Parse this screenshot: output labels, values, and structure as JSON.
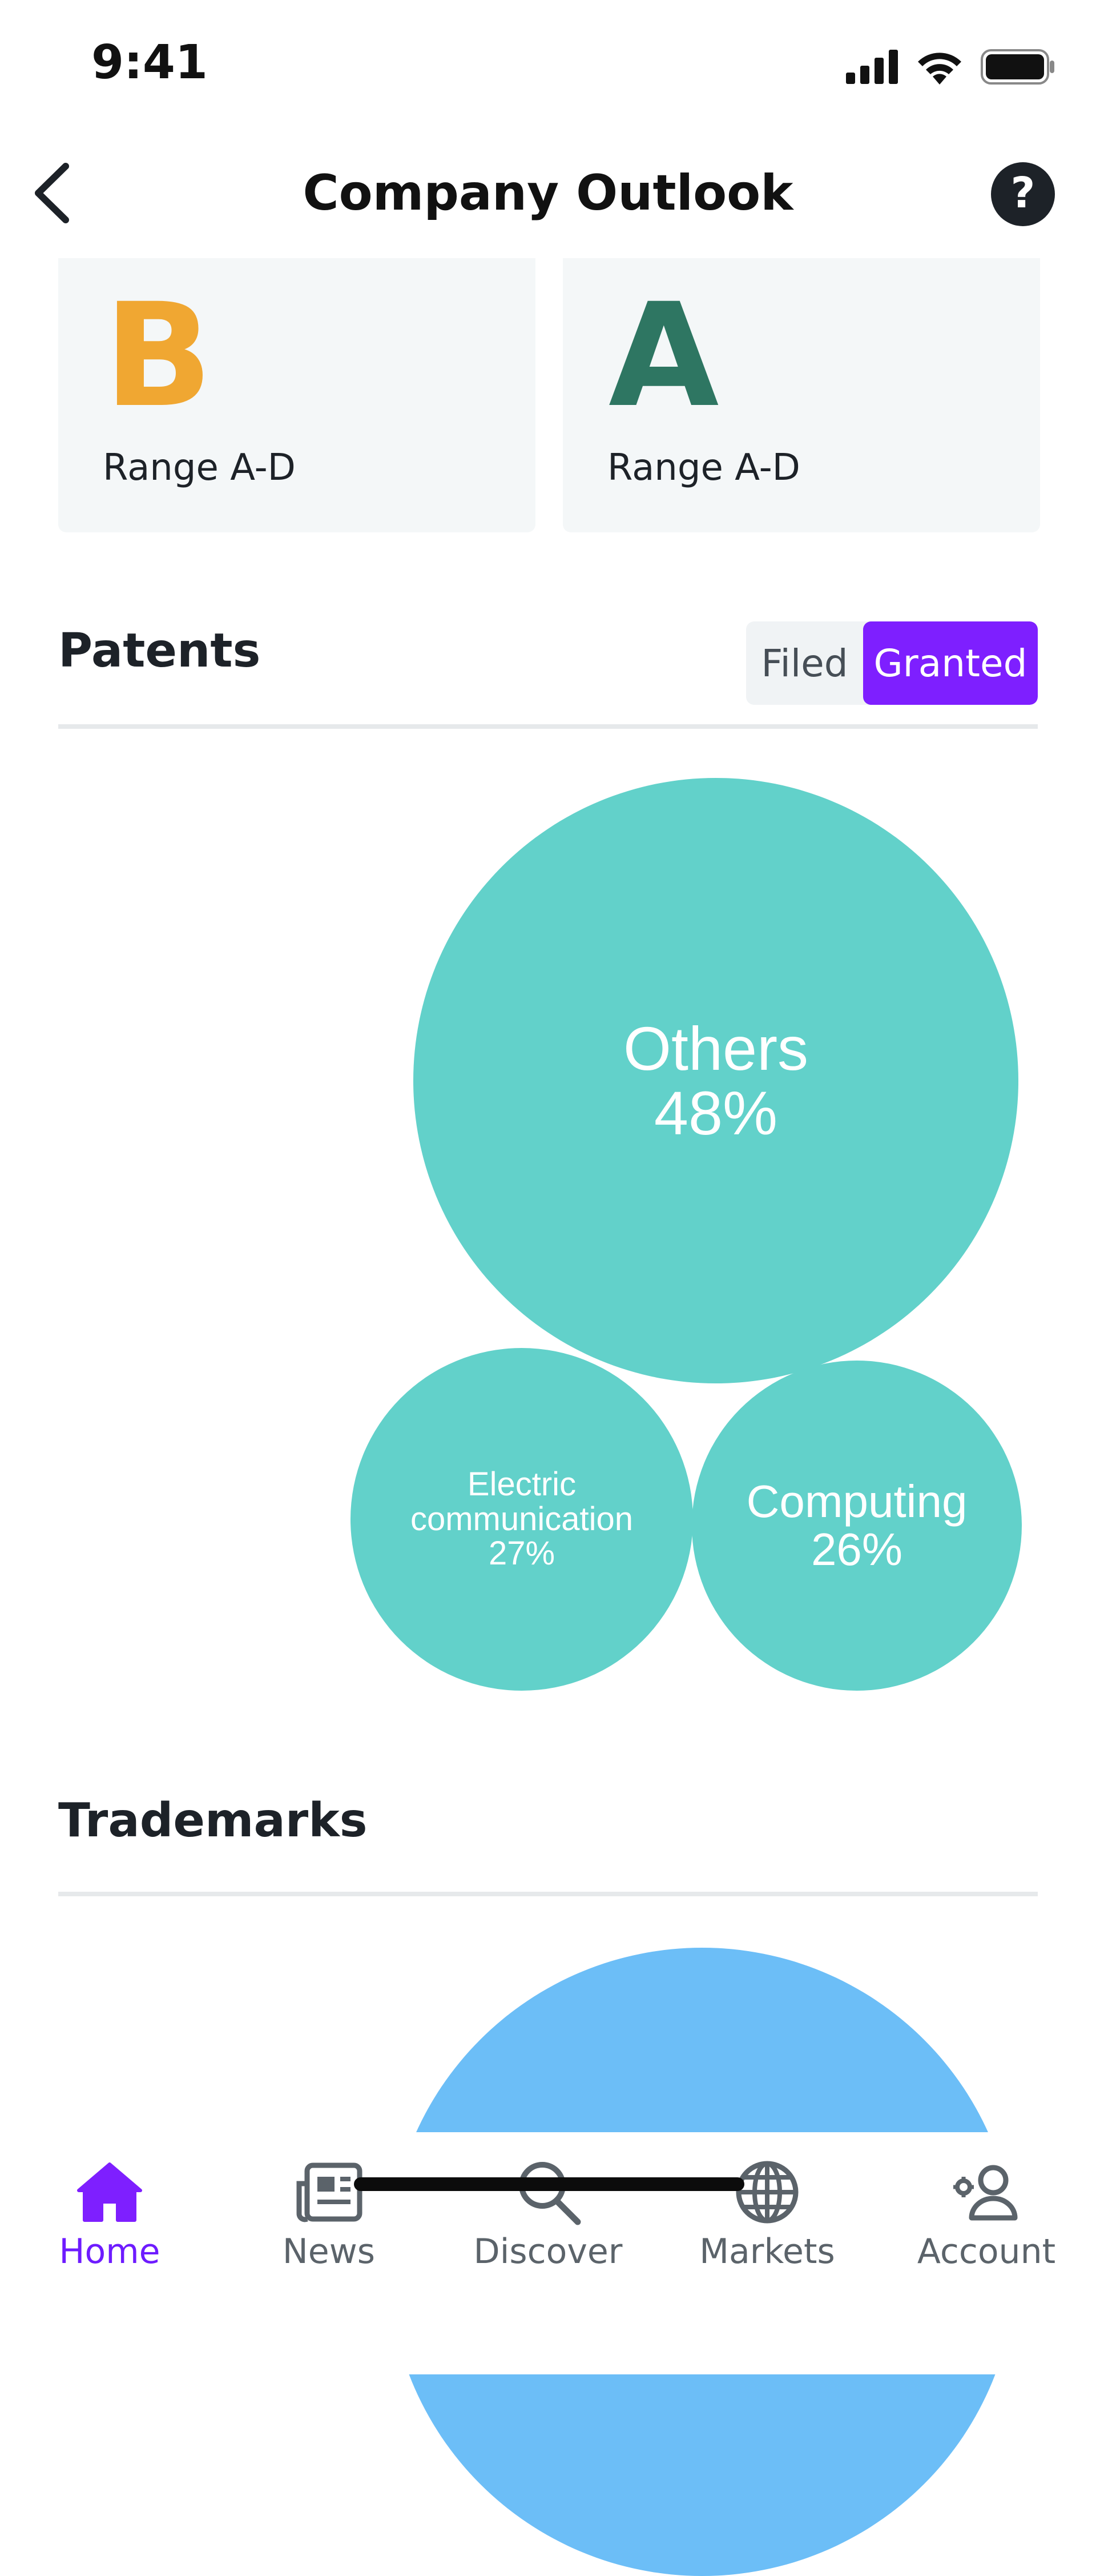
{
  "status_bar": {
    "time": "9:41",
    "icons": [
      "signal-icon",
      "wifi-icon",
      "battery-icon"
    ]
  },
  "header": {
    "title": "Company Outlook",
    "back_icon": "chevron-left-icon",
    "help_label": "?"
  },
  "grade_cards": [
    {
      "grade": "B",
      "range": "Range A-D",
      "color": "#f0a732"
    },
    {
      "grade": "A",
      "range": "Range A-D",
      "color": "#2e7662"
    }
  ],
  "patents": {
    "title": "Patents",
    "toggle": {
      "options": [
        "Filed",
        "Granted"
      ],
      "selected": "Granted"
    },
    "bubbles": [
      {
        "label": "Others",
        "value": "48%"
      },
      {
        "label": "Electric communication",
        "value": "27%"
      },
      {
        "label": "Computing",
        "value": "26%"
      }
    ]
  },
  "trademarks": {
    "title": "Trademarks"
  },
  "colors": {
    "accent": "#7e1fff",
    "bubble_patents": "#62d1ca",
    "bubble_trademarks": "#6cbef7",
    "tab_active": "#6e1bff",
    "tab_inactive": "#5b636a"
  },
  "tab_bar": {
    "items": [
      {
        "label": "Home",
        "icon": "home-icon",
        "active": true
      },
      {
        "label": "News",
        "icon": "newspaper-icon",
        "active": false
      },
      {
        "label": "Discover",
        "icon": "search-icon",
        "active": false
      },
      {
        "label": "Markets",
        "icon": "globe-icon",
        "active": false
      },
      {
        "label": "Account",
        "icon": "account-icon",
        "active": false
      }
    ]
  }
}
